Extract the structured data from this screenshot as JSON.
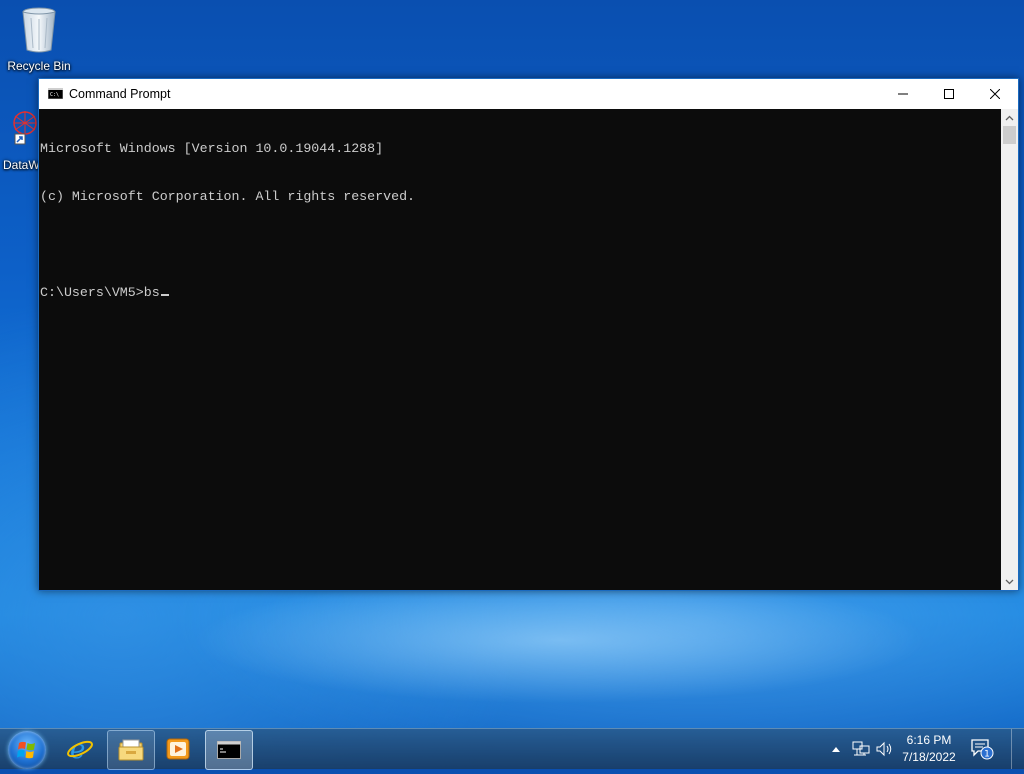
{
  "desktop": {
    "icons": [
      {
        "label": "Recycle Bin",
        "icon": "recycle-bin-icon"
      },
      {
        "label": "DataW",
        "icon": "datawiz-shortcut-icon"
      }
    ]
  },
  "window": {
    "title": "Command Prompt",
    "icon": "cmd-icon",
    "buttons": [
      "minimize-icon",
      "maximize-icon",
      "close-icon"
    ],
    "console_lines": [
      "Microsoft Windows [Version 10.0.19044.1288]",
      "(c) Microsoft Corporation. All rights reserved.",
      "",
      "C:\\Users\\VM5>bs"
    ]
  },
  "taskbar": {
    "pinned": [
      "internet-explorer-icon",
      "file-explorer-icon",
      "media-player-icon",
      "cmd-icon"
    ],
    "clock": {
      "time": "6:16 PM",
      "date": "7/18/2022"
    },
    "notification_count": "1",
    "accent": "#1a6ac0"
  }
}
